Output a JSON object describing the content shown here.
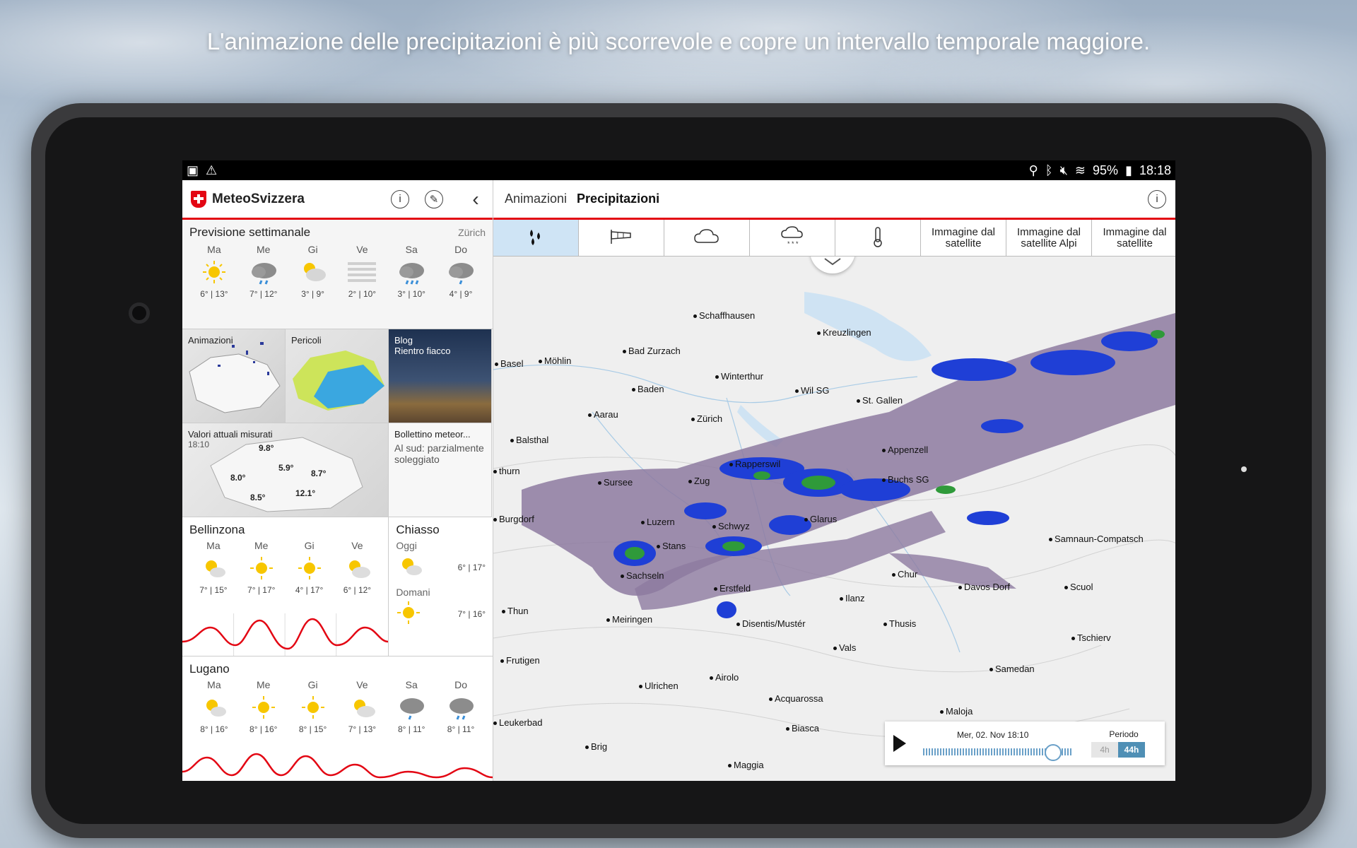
{
  "headline": "L'animazione delle precipitazioni è più scorrevole e copre un intervallo temporale maggiore.",
  "statusbar": {
    "battery": "95%",
    "time": "18:18"
  },
  "app": {
    "title": "MeteoSvizzera"
  },
  "week": {
    "title": "Previsione settimanale",
    "location": "Zürich",
    "days": [
      {
        "name": "Ma",
        "icon": "sun-icon",
        "temps": "6° | 13°"
      },
      {
        "name": "Me",
        "icon": "rain-cloud-icon",
        "temps": "7° | 12°"
      },
      {
        "name": "Gi",
        "icon": "sun-cloud-icon",
        "temps": "3° | 9°"
      },
      {
        "name": "Ve",
        "icon": "fog-icon",
        "temps": "2° | 10°"
      },
      {
        "name": "Sa",
        "icon": "rain-cloud-icon",
        "temps": "3° | 10°"
      },
      {
        "name": "Do",
        "icon": "rain-cloud-icon",
        "temps": "4° | 9°"
      }
    ]
  },
  "tiles": {
    "animations": "Animazioni",
    "hazards": "Pericoli",
    "blog_title": "Blog",
    "blog_sub": "Rientro fiacco",
    "values_title": "Valori attuali misurati",
    "values_time": "18:10",
    "values": [
      "9.8°",
      "5.9°",
      "8.0°",
      "8.7°",
      "8.5°",
      "12.1°"
    ],
    "bulletin_title": "Bollettino meteor...",
    "bulletin_text": "Al sud: parzialmente soleggiato"
  },
  "bellinzona": {
    "city": "Bellinzona",
    "days": [
      {
        "name": "Ma",
        "temps": "7° | 15°"
      },
      {
        "name": "Me",
        "temps": "7° | 17°"
      },
      {
        "name": "Gi",
        "temps": "4° | 17°"
      },
      {
        "name": "Ve",
        "temps": "6° | 12°"
      }
    ]
  },
  "chiasso": {
    "city": "Chiasso",
    "today": "Oggi",
    "today_temps": "6° | 17°",
    "tomorrow": "Domani",
    "tomorrow_temps": "7° | 16°"
  },
  "lugano": {
    "city": "Lugano",
    "days": [
      {
        "name": "Ma",
        "temps": "8° | 16°"
      },
      {
        "name": "Me",
        "temps": "8° | 16°"
      },
      {
        "name": "Gi",
        "temps": "8° | 15°"
      },
      {
        "name": "Ve",
        "temps": "7° | 13°"
      },
      {
        "name": "Sa",
        "temps": "8° | 11°"
      },
      {
        "name": "Do",
        "temps": "8° | 11°"
      }
    ]
  },
  "right": {
    "crumb": "Animazioni",
    "title": "Precipitazioni",
    "tabs": [
      "Immagine dal satellite",
      "Immagine dal satellite Alpi",
      "Immagine dal satellite"
    ]
  },
  "map_labels": [
    "Schaffhausen",
    "Kreuzlingen",
    "Bad Zurzach",
    "Basel",
    "Möhlin",
    "Winterthur",
    "Wil SG",
    "St. Gallen",
    "Baden",
    "Aarau",
    "Zürich",
    "Balsthal",
    "Rapperswil",
    "Appenzell",
    "thurn",
    "Sursee",
    "Zug",
    "Buchs SG",
    "Burgdorf",
    "Luzern",
    "Schwyz",
    "Glarus",
    "Stans",
    "Samnaun-Compatsch",
    "Sachseln",
    "Chur",
    "Davos Dorf",
    "Scuol",
    "Erstfeld",
    "Ilanz",
    "Thun",
    "Meiringen",
    "Disentis/Mustér",
    "Thusis",
    "Tschierv",
    "Vals",
    "Frutigen",
    "Samedan",
    "Airolo",
    "Ulrichen",
    "Acquarossa",
    "Maloja",
    "Leukerbad",
    "Biasca",
    "Brig",
    "Maggia"
  ],
  "player": {
    "datetime": "Mer, 02. Nov 18:10",
    "period_label": "Periodo",
    "options": [
      "4h",
      "44h"
    ]
  }
}
